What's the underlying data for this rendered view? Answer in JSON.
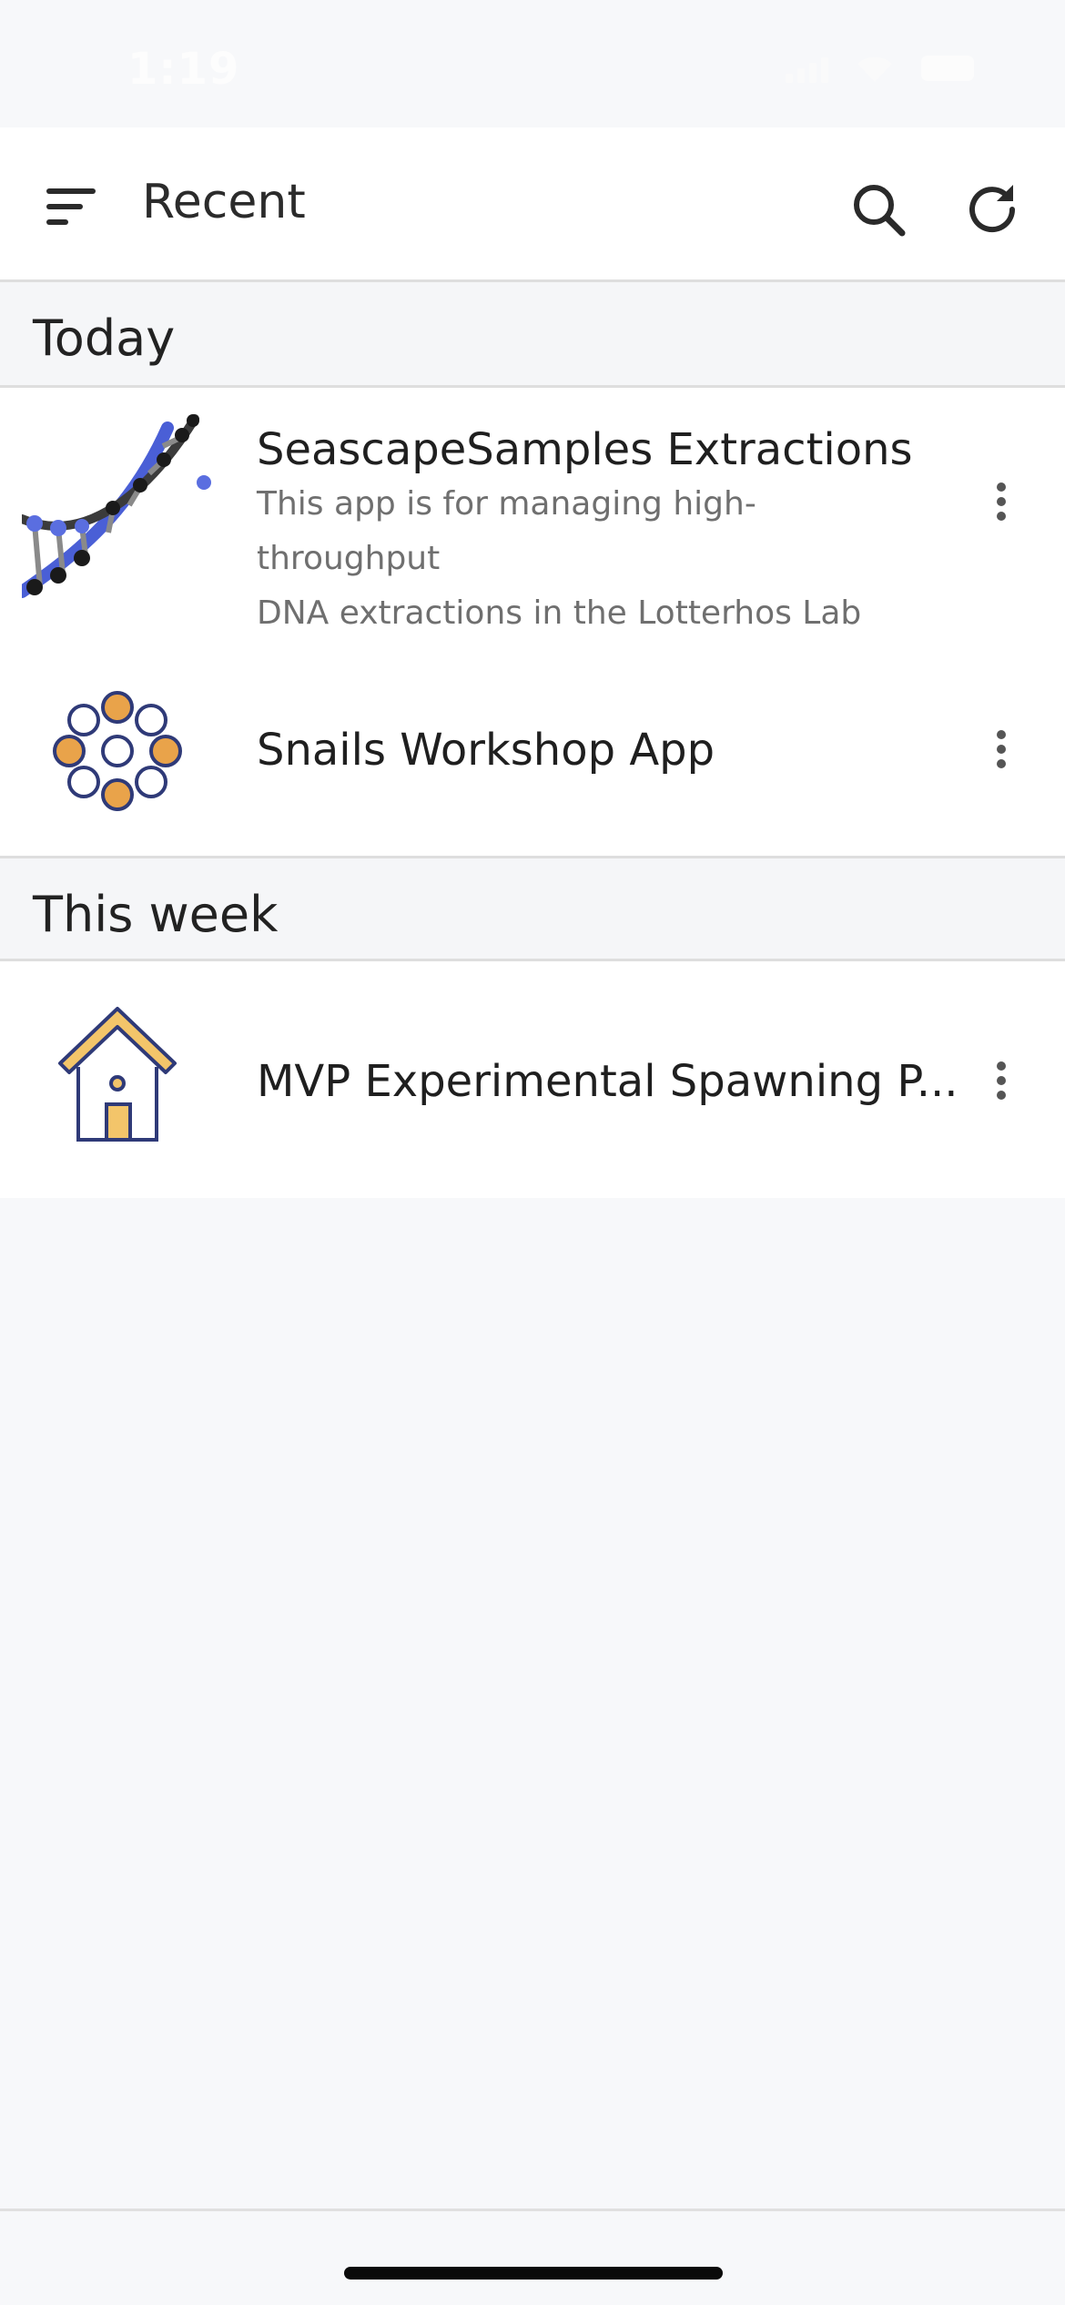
{
  "status_bar": {
    "time": "1:19"
  },
  "header": {
    "title": "Recent",
    "menu_icon": "filter-menu-icon",
    "search_icon": "search-icon",
    "refresh_icon": "refresh-icon"
  },
  "sections": [
    {
      "label": "Today",
      "items": [
        {
          "title": "SeascapeSamples Extractions",
          "description_line1": "This app is for managing high-throughput",
          "description_line2": "DNA extractions in the Lotterhos Lab",
          "icon": "dna-helix-image"
        },
        {
          "title": "Snails Workshop App",
          "icon": "circle-dots-icon"
        }
      ]
    },
    {
      "label": "This week",
      "items": [
        {
          "title": "MVP Experimental Spawning P...",
          "icon": "house-icon"
        }
      ]
    }
  ],
  "colors": {
    "accent_orange": "#e9a34a",
    "icon_navy": "#2f3a78",
    "house_fill": "#f3c56a",
    "background": "#f7f8fa"
  }
}
